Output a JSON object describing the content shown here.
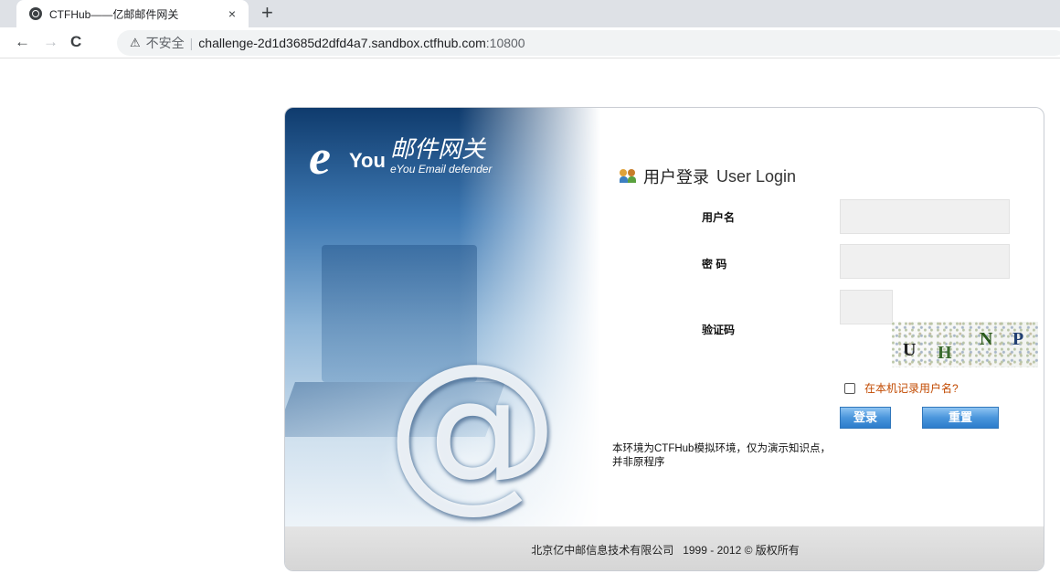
{
  "browser": {
    "tab_title": "CTFHub——亿邮邮件网关",
    "tab_close": "×",
    "new_tab": "+",
    "nav": {
      "back": "←",
      "forward": "→",
      "reload": "C"
    },
    "address": {
      "security_icon": "⚠",
      "security_text": "不安全",
      "separator": "|",
      "host": "challenge-2d1d3685d2dfd4a7.sandbox.ctfhub.com",
      "port": ":10800"
    }
  },
  "brand": {
    "logo_mark": "e",
    "logo_you": "You",
    "title_cn": "邮件网关",
    "title_en": "eYou Email defender",
    "decor_at": "@"
  },
  "login": {
    "heading_cn": "用户登录",
    "heading_en": "User Login",
    "username_label": "用户名",
    "password_label": "密 码",
    "captcha_label": "验证码",
    "captcha_chars": [
      "U",
      "H",
      "N",
      "P"
    ],
    "remember_label": "在本机记录用户名?",
    "login_button": "登录",
    "reset_button": "重置",
    "notice": "本环境为CTFHub模拟环境，仅为演示知识点，并非原程序"
  },
  "footer": {
    "copyright": "北京亿中邮信息技术有限公司   1999 - 2012 © 版权所有"
  },
  "colors": {
    "accent_button": "#4a96dc",
    "remember_text": "#c24a00",
    "footer_bg": "#dcdcdc"
  }
}
